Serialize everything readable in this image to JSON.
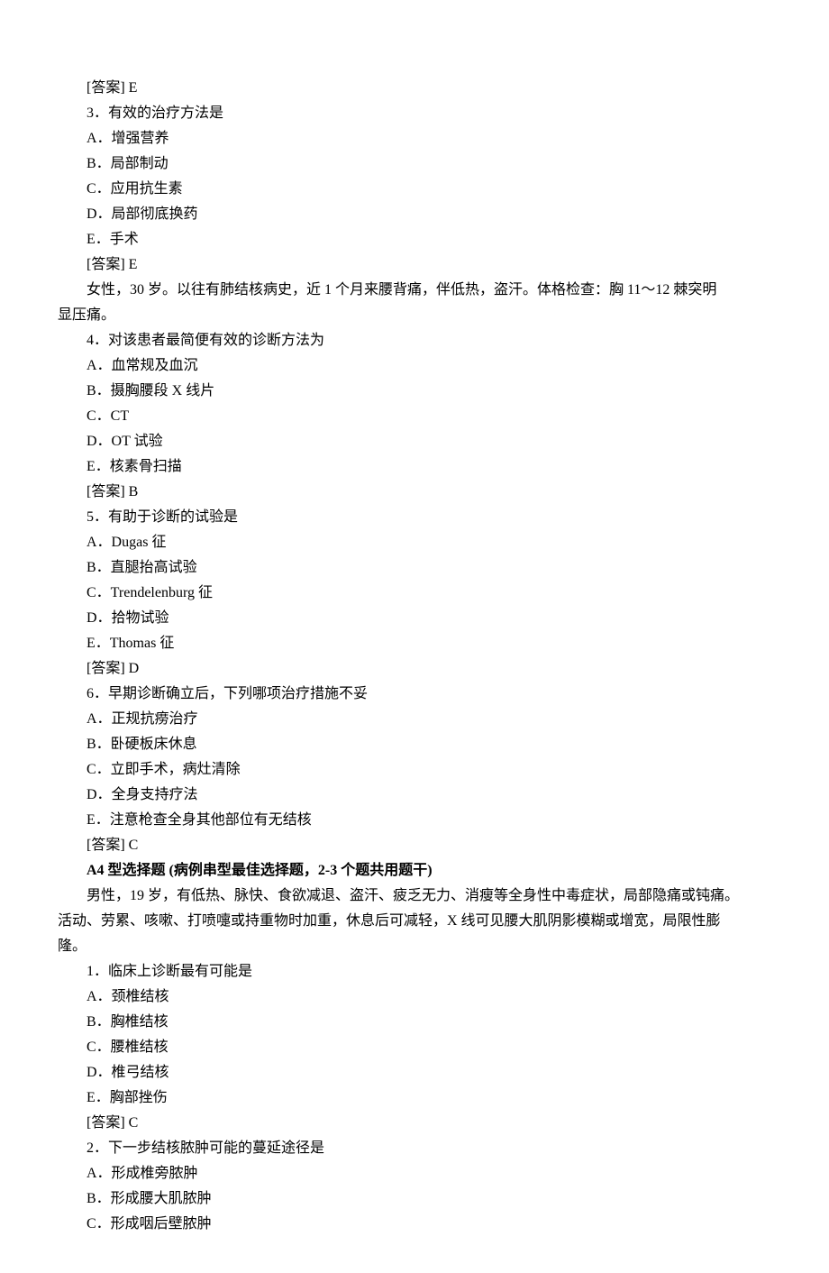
{
  "q3": {
    "answer_prev": "[答案] E",
    "number": "3．有效的治疗方法是",
    "A": "A．增强营养",
    "B": "B．局部制动",
    "C": "C．应用抗生素",
    "D": "D．局部彻底换药",
    "E": "E．手术",
    "answer": "[答案] E"
  },
  "case2": {
    "stem1": "女性，30 岁。以往有肺结核病史，近 1 个月来腰背痛，伴低热，盗汗。体格检查：胸 11～12 棘突明",
    "stem2": "显压痛。"
  },
  "q4": {
    "number": "4．对该患者最简便有效的诊断方法为",
    "A": "A．血常规及血沉",
    "B": "B．摄胸腰段 X 线片",
    "C": "C．CT",
    "D": "D．OT 试验",
    "E": "E．核素骨扫描",
    "answer": "[答案] B"
  },
  "q5": {
    "number": "5．有助于诊断的试验是",
    "A": "A．Dugas 征",
    "B": "B．直腿抬高试验",
    "C": "C．Trendelenburg 征",
    "D": "D．拾物试验",
    "E": "E．Thomas 征",
    "answer": "[答案] D"
  },
  "q6": {
    "number": "6．早期诊断确立后，下列哪项治疗措施不妥",
    "A": "A．正规抗痨治疗",
    "B": "B．卧硬板床休息",
    "C": "C．立即手术，病灶清除",
    "D": "D．全身支持疗法",
    "E": "E．注意枪查全身其他部位有无结核",
    "answer": "[答案] C"
  },
  "heading": "A4 型选择题  (病例串型最佳选择题，2-3 个题共用题干)",
  "case3": {
    "stem1": "男性，19 岁，有低热、脉快、食欲减退、盗汗、疲乏无力、消瘦等全身性中毒症状，局部隐痛或钝痛。",
    "stem2": "活动、劳累、咳嗽、打喷嚏或持重物时加重，休息后可减轻，X 线可见腰大肌阴影模糊或增宽，局限性膨",
    "stem3": "隆。"
  },
  "q1b": {
    "number": "1．临床上诊断最有可能是",
    "A": "A．颈椎结核",
    "B": "B．胸椎结核",
    "C": "C．腰椎结核",
    "D": "D．椎弓结核",
    "E": "E．胸部挫伤",
    "answer": "[答案] C"
  },
  "q2b": {
    "number": "2．下一步结核脓肿可能的蔓延途径是",
    "A": "A．形成椎旁脓肿",
    "B": "B．形成腰大肌脓肿",
    "C": "C．形成咽后壁脓肿"
  }
}
